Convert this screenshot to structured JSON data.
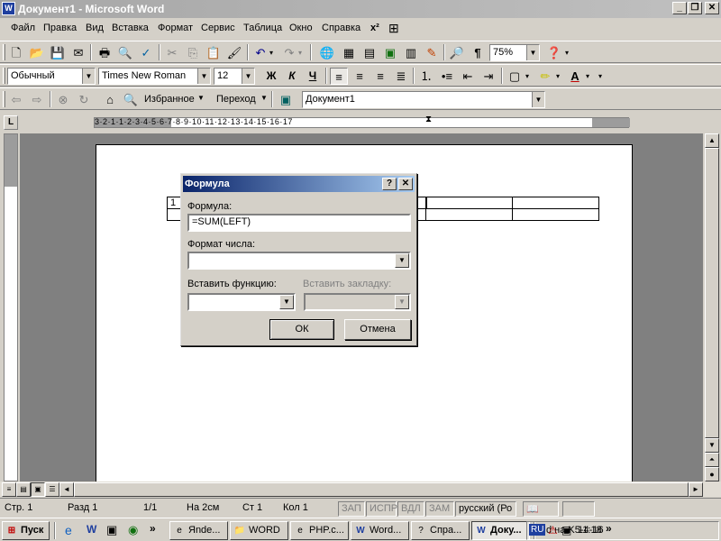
{
  "window": {
    "title": "Документ1 - Microsoft Word",
    "icon": "W"
  },
  "caption_buttons": [
    "_",
    "❐",
    "✕"
  ],
  "menu": [
    "Файл",
    "Правка",
    "Вид",
    "Вставка",
    "Формат",
    "Сервис",
    "Таблица",
    "Окно",
    "Справка"
  ],
  "standard_toolbar": {
    "zoom": "75%"
  },
  "formatting_toolbar": {
    "style": "Обычный",
    "font": "Times New Roman",
    "size": "12",
    "bold": "Ж",
    "italic": "К",
    "underline": "Ч"
  },
  "web_toolbar": {
    "favorites": "Избранное",
    "goto": "Переход",
    "address": "Документ1"
  },
  "ruler": {
    "text": "3·2·1·1·2·3·4·5·6·7·8·9·10·11·12·13·14·15·16·17",
    "corner": "L"
  },
  "document": {
    "cell_value": "1"
  },
  "dialog": {
    "title": "Формула",
    "help": "?",
    "close": "✕",
    "formula_label": "Формула:",
    "formula_value": "=SUM(LEFT)",
    "number_format_label": "Формат числа:",
    "number_format_value": "",
    "insert_function_label": "Вставить функцию:",
    "insert_bookmark_label": "Вставить закладку:",
    "ok": "ОК",
    "cancel": "Отмена"
  },
  "status": {
    "page": "Стр. 1",
    "section": "Разд 1",
    "pages": "1/1",
    "at": "На 2см",
    "line": "Ст 1",
    "col": "Кол 1",
    "rec": "ЗАП",
    "trk": "ИСПР",
    "ext": "ВДЛ",
    "ovr": "ЗАМ",
    "lang": "русский (Ро"
  },
  "taskbar": {
    "start": "Пуск",
    "buttons": [
      "Яnde...",
      "WORD",
      "PHP.c...",
      "Word...",
      "Спра...",
      "Доку...",
      "d на K5-4-16"
    ],
    "lang": "RU",
    "clock": "11:18"
  }
}
